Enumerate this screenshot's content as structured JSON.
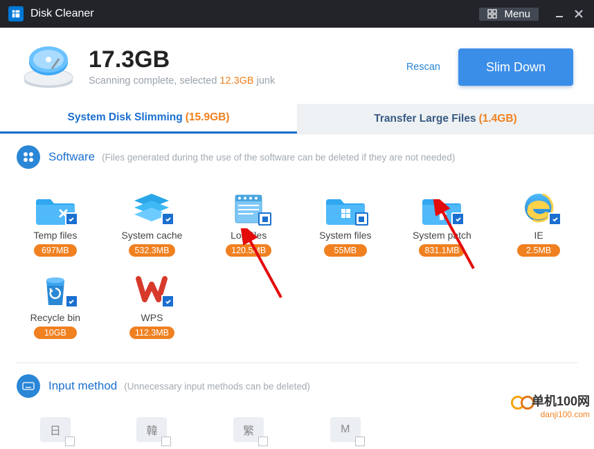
{
  "titlebar": {
    "title": "Disk Cleaner",
    "menu_label": "Menu"
  },
  "header": {
    "total_size": "17.3GB",
    "status_prefix": "Scanning complete, selected ",
    "junk_size": "12.3GB",
    "status_suffix": " junk",
    "rescan_label": "Rescan",
    "slim_button": "Slim Down"
  },
  "tabs": {
    "active": {
      "label": "System Disk Slimming",
      "size": "(15.9GB)"
    },
    "inactive": {
      "label": "Transfer Large Files",
      "size": "(1.4GB)"
    }
  },
  "sections": {
    "software": {
      "title": "Software",
      "desc": "(Files generated during the use of the software can be deleted if they are not needed)",
      "items": [
        {
          "label": "Temp files",
          "size": "697MB"
        },
        {
          "label": "System cache",
          "size": "532.3MB"
        },
        {
          "label": "Log files",
          "size": "120.5MB"
        },
        {
          "label": "System files",
          "size": "55MB"
        },
        {
          "label": "System patch",
          "size": "831.1MB"
        },
        {
          "label": "IE",
          "size": "2.5MB"
        },
        {
          "label": "Recycle bin",
          "size": "10GB"
        },
        {
          "label": "WPS",
          "size": "112.3MB"
        }
      ]
    },
    "input": {
      "title": "Input method",
      "desc": "(Unnecessary input methods can be deleted)",
      "items": [
        {
          "glyph": "日"
        },
        {
          "glyph": "韓"
        },
        {
          "glyph": "繁"
        },
        {
          "glyph": "M"
        }
      ]
    }
  },
  "watermark": {
    "cn": "单机100网",
    "url": "danji100.com"
  }
}
